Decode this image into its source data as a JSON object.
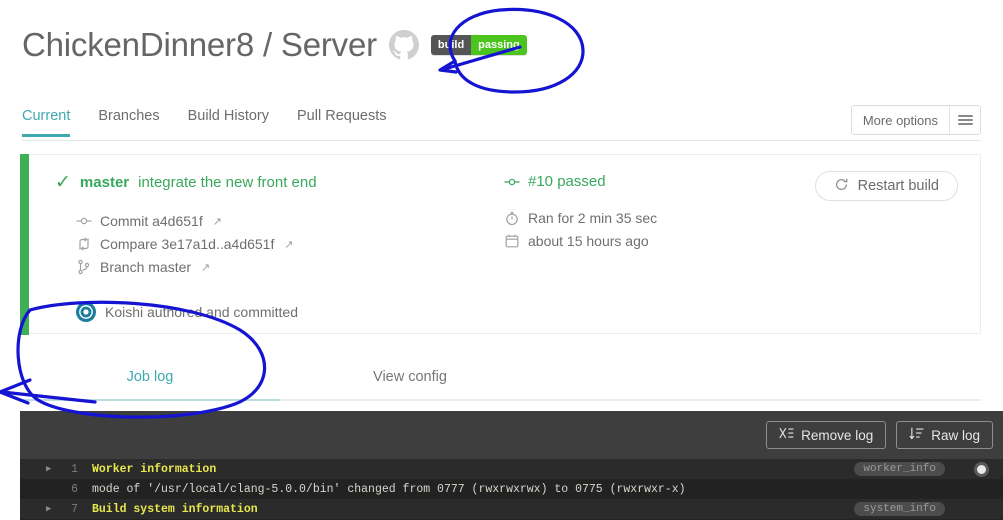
{
  "header": {
    "repo_title": "ChickenDinner8 / Server",
    "github_icon": "github-octocat-icon",
    "badge": {
      "left_label": "build",
      "right_label": "passing",
      "left_color": "#555555",
      "right_color": "#4bc51d"
    }
  },
  "tabs": {
    "items": [
      {
        "label": "Current",
        "active": true
      },
      {
        "label": "Branches",
        "active": false
      },
      {
        "label": "Build History",
        "active": false
      },
      {
        "label": "Pull Requests",
        "active": false
      }
    ],
    "more_options": {
      "label": "More options",
      "icon": "hamburger-icon"
    },
    "active_color": "#3eaaaf"
  },
  "build": {
    "status_color": "#3eaf57",
    "status_icon": "check-icon",
    "branch": "master",
    "commit_message": "integrate the new front end",
    "meta": [
      {
        "icon": "commit-icon",
        "label": "Commit a4d651f",
        "external": "↗"
      },
      {
        "icon": "compare-icon",
        "label": "Compare 3e17a1d..a4d651f",
        "external": "↗"
      },
      {
        "icon": "branch-icon",
        "label": "Branch master",
        "external": "↗"
      }
    ],
    "author": {
      "avatar_icon": "user-avatar",
      "text": "Koishi authored and committed"
    },
    "build_number": "#10 passed",
    "build_number_icon": "commit-icon",
    "duration": "Ran for 2 min 35 sec",
    "duration_icon": "stopwatch-icon",
    "when": "about 15 hours ago",
    "when_icon": "calendar-icon",
    "restart_button": {
      "label": "Restart build",
      "icon": "refresh-icon"
    }
  },
  "subtabs": {
    "items": [
      {
        "label": "Job log",
        "active": true
      },
      {
        "label": "View config",
        "active": false
      }
    ]
  },
  "log": {
    "buttons": [
      {
        "label": "Remove log",
        "icon": "remove-log-icon"
      },
      {
        "label": "Raw log",
        "icon": "raw-log-icon"
      }
    ],
    "lines": [
      {
        "number": "1",
        "text": "Worker information",
        "highlight": true,
        "foldable": true,
        "tag": "worker_info",
        "dot": true
      },
      {
        "number": "6",
        "text": "mode of '/usr/local/clang-5.0.0/bin' changed from 0777 (rwxrwxrwx) to 0775 (rwxrwxr-x)",
        "highlight": false,
        "foldable": false,
        "tag": "",
        "dot": false
      },
      {
        "number": "7",
        "text": "Build system information",
        "highlight": true,
        "foldable": true,
        "tag": "system_info",
        "dot": false
      }
    ]
  },
  "annotations": {
    "color": "#1414d2",
    "shapes": [
      {
        "name": "circle-around-build-badge"
      },
      {
        "name": "circle-around-job-log-tab"
      }
    ]
  }
}
